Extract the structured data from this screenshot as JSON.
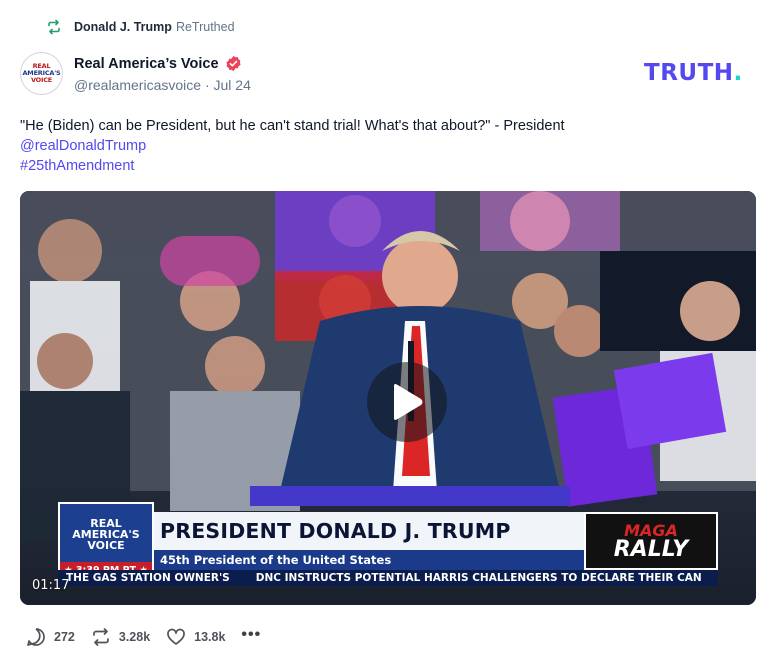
{
  "retruth": {
    "name": "Donald J. Trump",
    "suffix": "ReTruthed",
    "icon": "retruth-icon"
  },
  "author": {
    "name": "Real America’s Voice",
    "handle": "@realamericasvoice",
    "date": "Jul 24",
    "avatar_lines": [
      "REAL",
      "AMERICA'S",
      "VOICE"
    ],
    "verified_icon": "verified-badge-icon"
  },
  "logo": {
    "text": "TRUTH",
    "dot": "."
  },
  "post": {
    "text": "\"He (Biden) can be President, but he can't stand trial! What's that about?\" - President",
    "mention": "@realDonaldTrump",
    "hashtag": "#25thAmendment"
  },
  "video": {
    "timestamp": "01:17",
    "overlay": {
      "brand_lines": [
        "REAL",
        "AMERICA'S",
        "VOICE"
      ],
      "time": "★ 3:39 PM PT ★",
      "headline": "PRESIDENT DONALD J. TRUMP",
      "subtitle": "45th President of the United States",
      "rally_top": "MAGA",
      "rally_bottom": "RALLY",
      "ticker_1": "THE GAS STATION OWNER'S",
      "ticker_2": "DNC INSTRUCTS POTENTIAL HARRIS CHALLENGERS TO DECLARE THEIR CAN"
    },
    "play_icon": "play-icon"
  },
  "actions": {
    "replies": "272",
    "retruths": "3.28k",
    "likes": "13.8k",
    "more": "•••"
  },
  "colors": {
    "brand": "#5448ee",
    "brand_dot": "#17d7c6",
    "verified": "#e8445a",
    "retruth_icon": "#22a06b"
  }
}
